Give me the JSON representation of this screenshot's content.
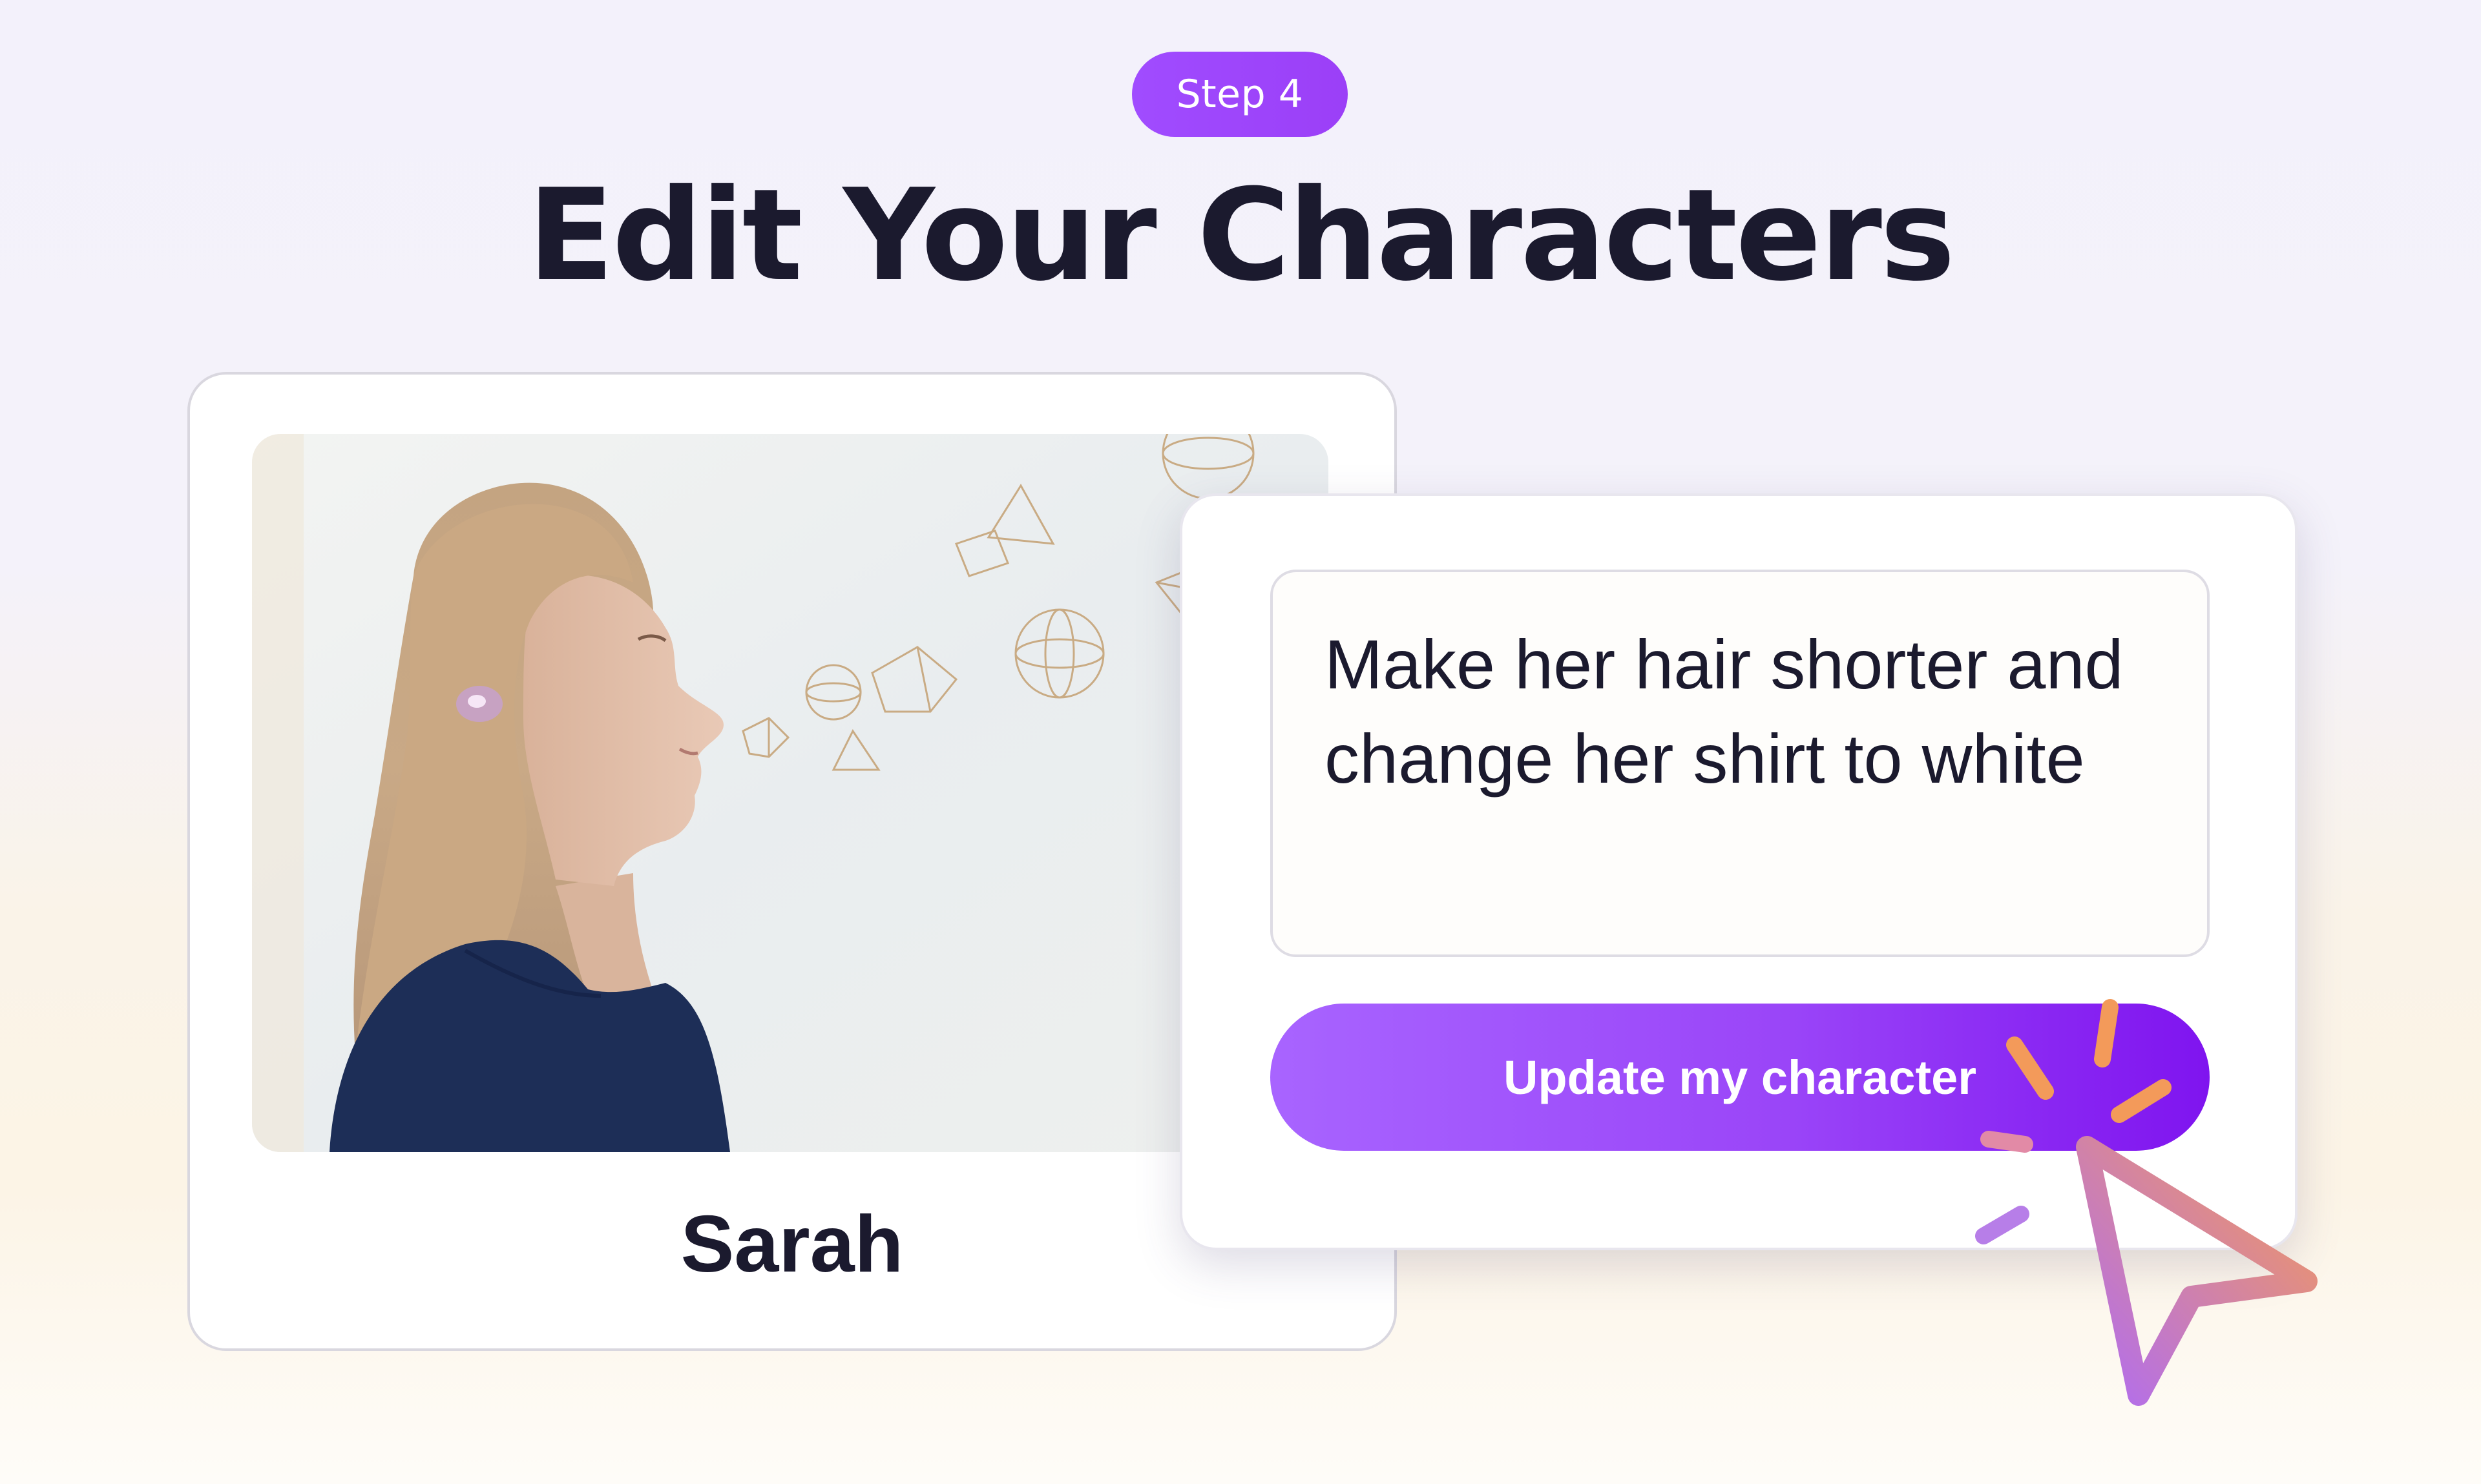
{
  "header": {
    "step_label": "Step 4",
    "title": "Edit Your Characters"
  },
  "character_card": {
    "name": "Sarah",
    "photo_description": "profile-photo"
  },
  "edit_panel": {
    "prompt_text": "Make her hair shorter and change her shirt to white",
    "button_label": "Update my character"
  },
  "colors": {
    "accent": "#9b3ff7",
    "title_text": "#1b1a2e",
    "cursor_gradient_start": "#b06cf2",
    "cursor_gradient_end": "#f39a5a"
  },
  "icons": {
    "cursor": "pointer-cursor-icon",
    "click": "click-burst-icon"
  }
}
